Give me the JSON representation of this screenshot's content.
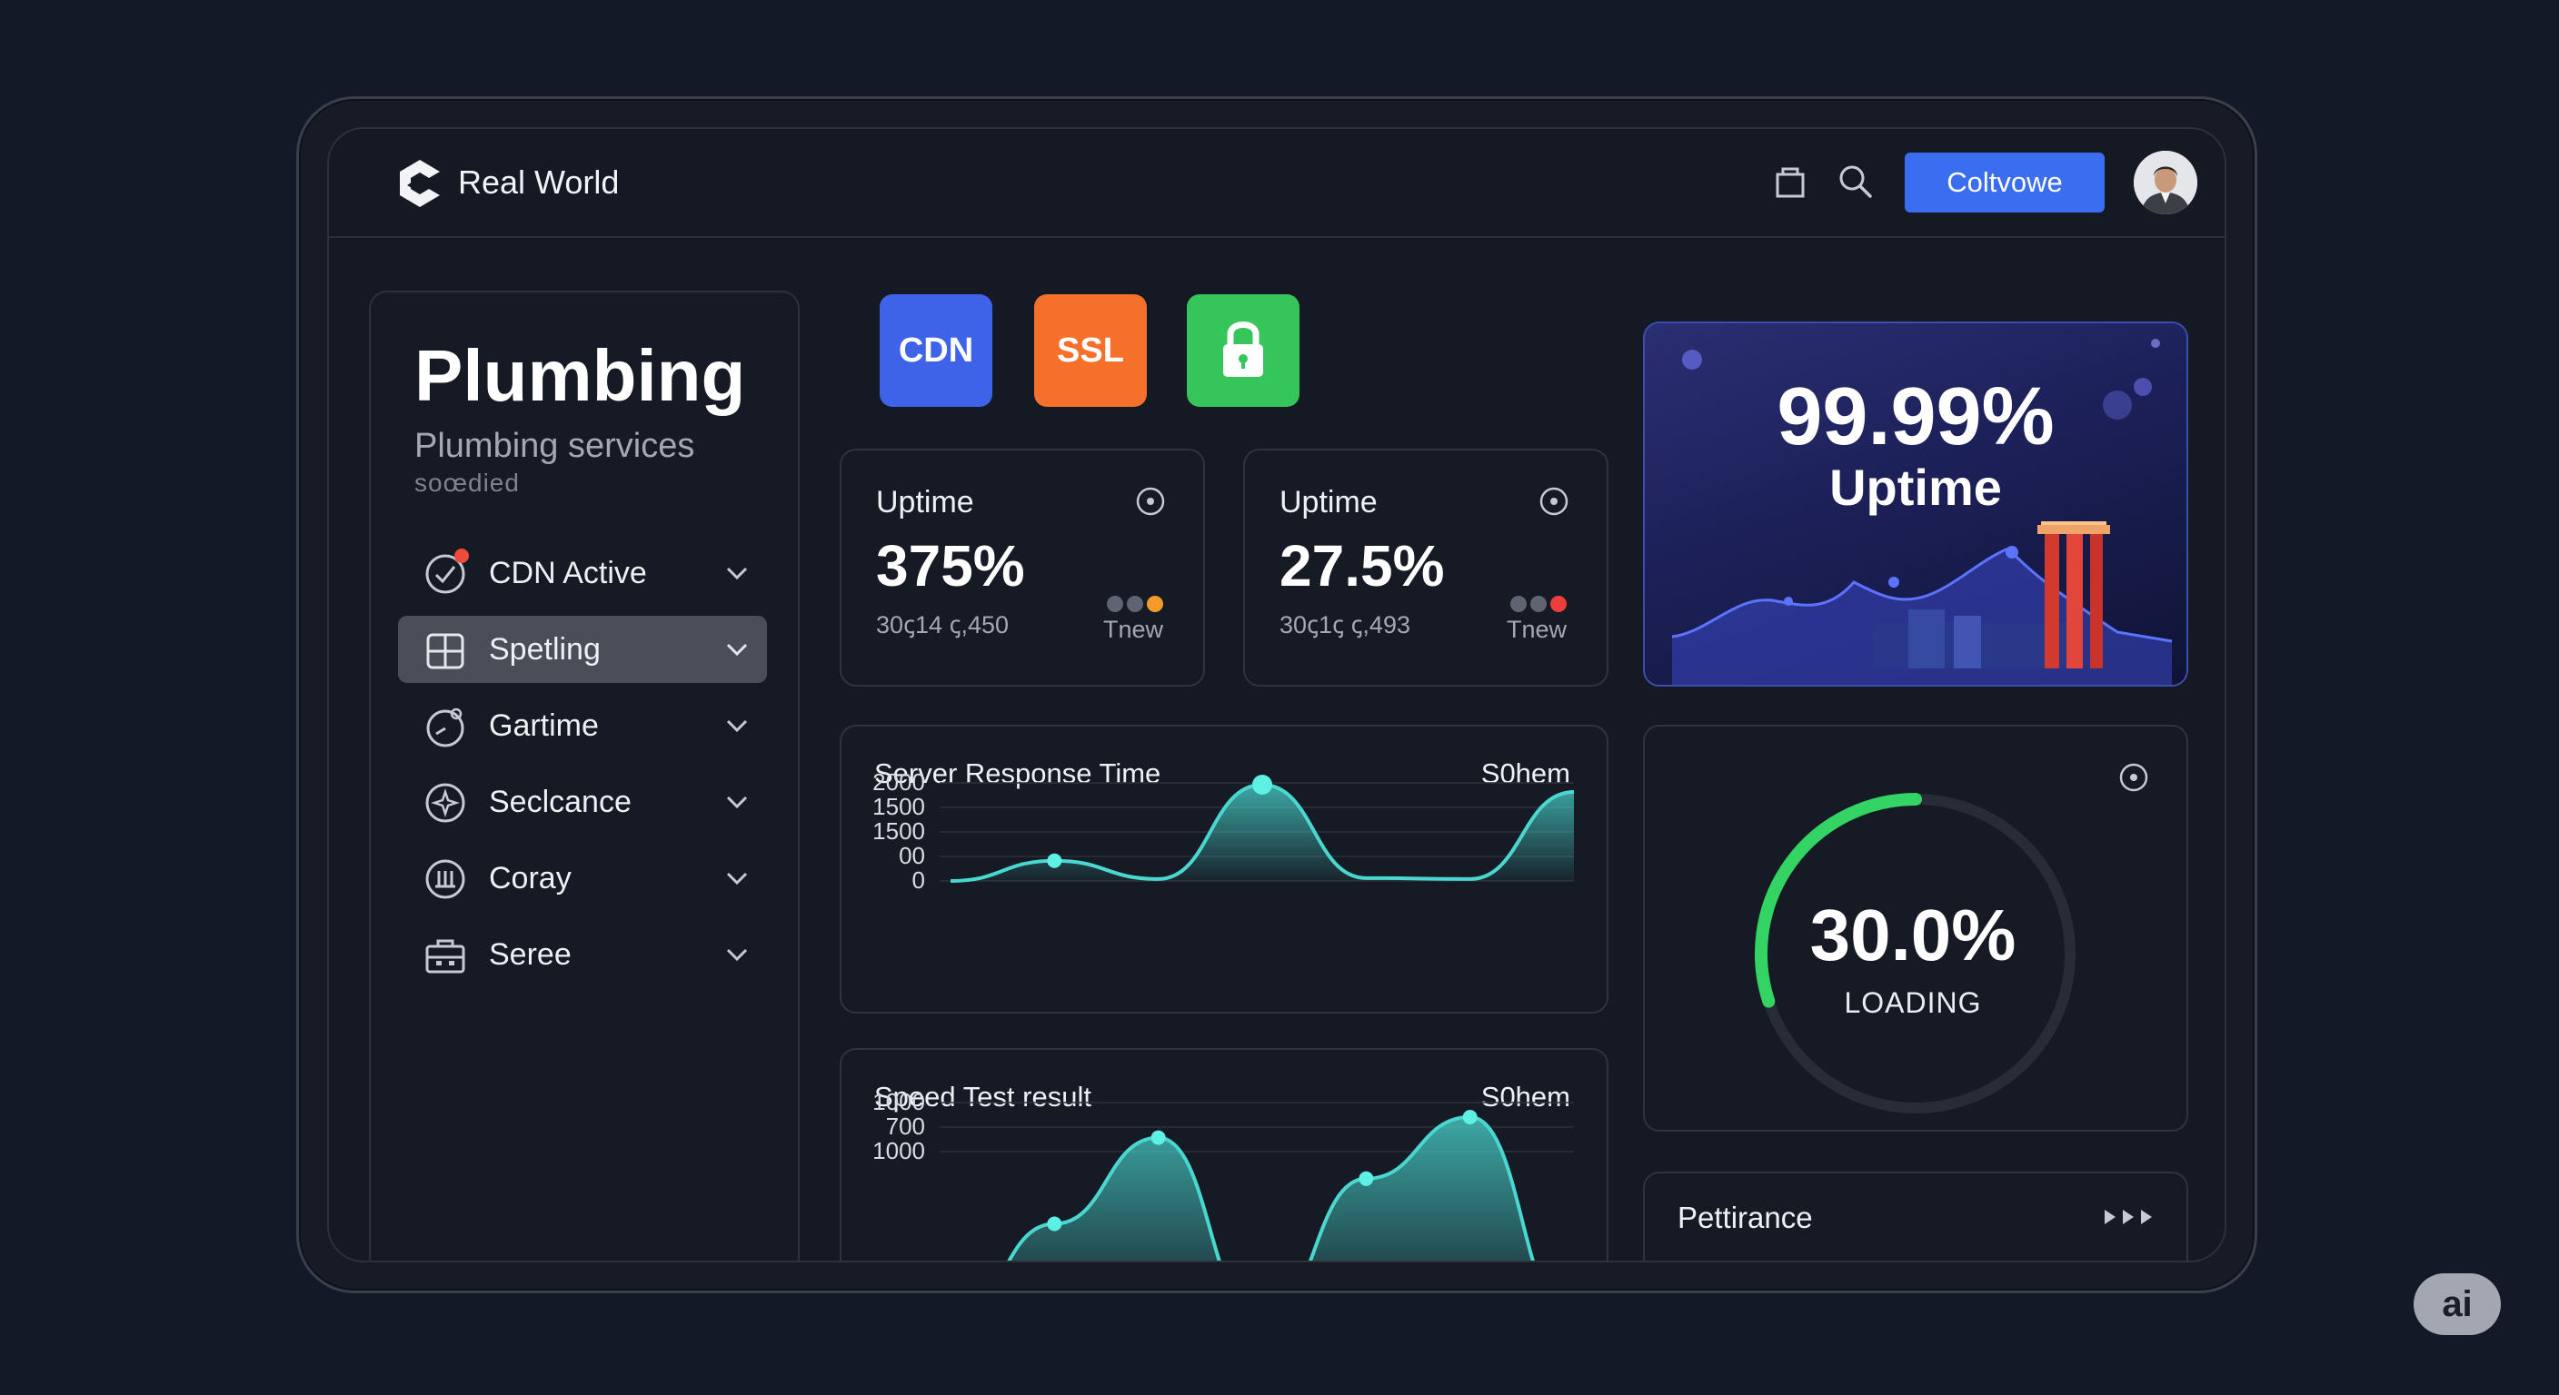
{
  "header": {
    "brand": "Real World",
    "cta_label": "Coltvowe"
  },
  "sidebar": {
    "title": "Plumbing",
    "subtitle": "Plumbing services",
    "caption": "soœdied",
    "items": [
      {
        "label": "CDN Active",
        "icon": "check-circle-icon",
        "active": false
      },
      {
        "label": "Spetling",
        "icon": "grid-box-icon",
        "active": true
      },
      {
        "label": "Gartime",
        "icon": "gauge-icon",
        "active": false
      },
      {
        "label": "Seclcance",
        "icon": "compass-icon",
        "active": false
      },
      {
        "label": "Coray",
        "icon": "bars-circle-icon",
        "active": false
      },
      {
        "label": "Seree",
        "icon": "briefcase-icon",
        "active": false
      }
    ]
  },
  "tiles": [
    {
      "label": "CDN",
      "color": "#3e63e8"
    },
    {
      "label": "SSL",
      "color": "#f5712b"
    },
    {
      "label": "lock",
      "color": "#35c55a"
    }
  ],
  "stat_cards": [
    {
      "title": "Uptime",
      "value": "375%",
      "sub": "30ꞔ14 ꞔ,450",
      "tag": "Tnew",
      "dots": [
        "#5f6472",
        "#5f6472",
        "#f39a2a"
      ]
    },
    {
      "title": "Uptime",
      "value": "27.5%",
      "sub": "30ꞔ1ꞔ ꞔ,493",
      "tag": "Tnew",
      "dots": [
        "#5f6472",
        "#5f6472",
        "#ee3d3d"
      ]
    }
  ],
  "hero": {
    "value": "99.99%",
    "label": "Uptime",
    "accent": "#4a5cff"
  },
  "gauge": {
    "value": "30.0%",
    "label": "LOADING",
    "fraction": 0.3,
    "color": "#33d463"
  },
  "performance": {
    "label": "Pettirance"
  },
  "chart_data": [
    {
      "type": "area",
      "title": "Server Response Time",
      "corner_label": "S0hem",
      "ytick_labels": [
        "2000",
        "1500",
        "1500",
        "00",
        "0"
      ],
      "series": [
        {
          "x": [
            0,
            1,
            2,
            3,
            4,
            5,
            6
          ],
          "y": [
            0,
            420,
            40,
            2000,
            60,
            40,
            1850
          ]
        }
      ],
      "markers": [
        {
          "x": 1,
          "y": 420
        },
        {
          "x": 3,
          "y": 2000
        }
      ],
      "color": "#49d7d0"
    },
    {
      "type": "area",
      "title": "Speed Test result",
      "corner_label": "S0hem",
      "ytick_labels": [
        "1000",
        "700",
        "1000"
      ],
      "series": [
        {
          "x": [
            0,
            1,
            2,
            3,
            4,
            5,
            6
          ],
          "y": [
            0,
            480,
            900,
            0,
            700,
            1000,
            0
          ]
        }
      ],
      "markers": [
        {
          "x": 1,
          "y": 480
        },
        {
          "x": 2,
          "y": 900
        },
        {
          "x": 4,
          "y": 700
        },
        {
          "x": 5,
          "y": 1000
        }
      ],
      "color": "#49d7d0"
    }
  ],
  "badge": {
    "label": "ai"
  }
}
